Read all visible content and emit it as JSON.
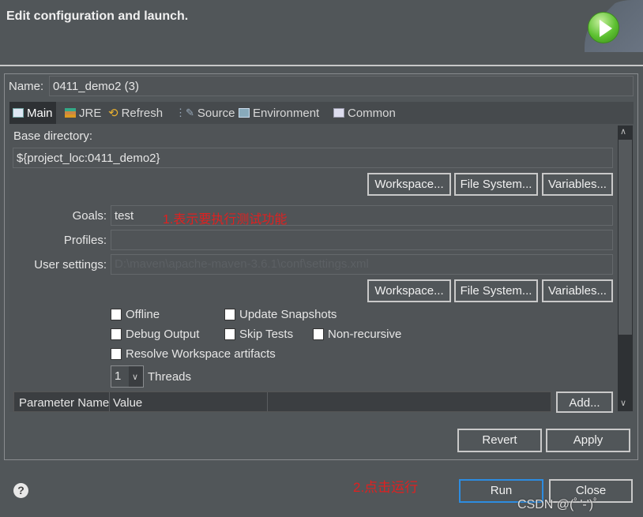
{
  "header": {
    "title": "Edit configuration and launch."
  },
  "name": {
    "label": "Name:",
    "value": "0411_demo2 (3)"
  },
  "tabs": [
    {
      "label": "Main",
      "icon": "main-tab-icon"
    },
    {
      "label": "JRE",
      "icon": "jre-icon"
    },
    {
      "label": "Refresh",
      "icon": "refresh-icon"
    },
    {
      "label": "Source",
      "icon": "source-icon"
    },
    {
      "label": "Environment",
      "icon": "environment-icon"
    },
    {
      "label": "Common",
      "icon": "common-icon"
    }
  ],
  "main": {
    "base_dir_label": "Base directory:",
    "base_dir_value": "${project_loc:0411_demo2}",
    "workspace": "Workspace...",
    "file_system": "File System...",
    "variables": "Variables...",
    "goals_label": "Goals:",
    "goals_value": "test",
    "goals_annotation": "1.表示要执行测试功能",
    "profiles_label": "Profiles:",
    "profiles_value": "",
    "user_settings_label": "User settings:",
    "user_settings_placeholder": "D:\\maven\\apache-maven-3.6.1\\conf\\settings.xml",
    "checkboxes": [
      {
        "label": "Offline",
        "checked": false
      },
      {
        "label": "Update Snapshots",
        "checked": false
      },
      {
        "label": "Debug Output",
        "checked": false
      },
      {
        "label": "Skip Tests",
        "checked": false
      },
      {
        "label": "Non-recursive",
        "checked": false
      },
      {
        "label": "Resolve Workspace artifacts",
        "checked": false
      }
    ],
    "threads_value": "1",
    "threads_label": "Threads",
    "table_headers": [
      "Parameter Name",
      "Value"
    ],
    "add": "Add..."
  },
  "buttons": {
    "revert": "Revert",
    "apply": "Apply",
    "run": "Run",
    "close": "Close"
  },
  "run_annotation": "2.点击运行",
  "watermark": "CSDN @(ﾟ'-')ﾟ"
}
